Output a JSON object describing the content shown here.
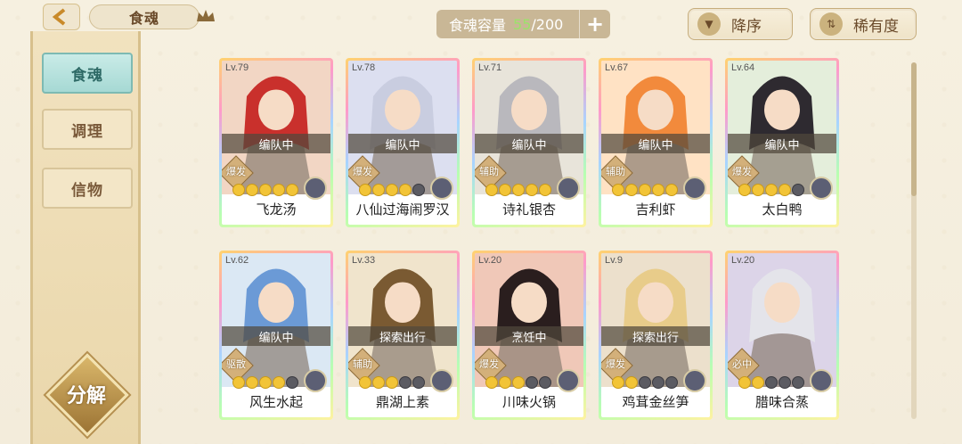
{
  "header": {
    "title_tab": "食魂",
    "capacity_label": "食魂容量",
    "capacity_current": "55",
    "capacity_max": "/200",
    "add_label": "+",
    "sort_order_label": "降序",
    "sort_by_label": "稀有度"
  },
  "sidebar": {
    "tabs": [
      {
        "label": "食魂",
        "active": true
      },
      {
        "label": "调理",
        "active": false
      },
      {
        "label": "信物",
        "active": false
      }
    ],
    "decompose_label": "分解"
  },
  "cards": [
    {
      "level": "Lv.79",
      "status": "编队中",
      "role": "爆发",
      "name": "飞龙汤",
      "stars": 5,
      "stars_filled": 5,
      "hair": "#c9302c",
      "bg": "#f2d6c4"
    },
    {
      "level": "Lv.78",
      "status": "编队中",
      "role": "爆发",
      "name": "八仙过海闹罗汉",
      "stars": 5,
      "stars_filled": 4,
      "hair": "#c9cde0",
      "bg": "#dcdff0"
    },
    {
      "level": "Lv.71",
      "status": "编队中",
      "role": "辅助",
      "name": "诗礼银杏",
      "stars": 5,
      "stars_filled": 5,
      "hair": "#b9b8bd",
      "bg": "#e8e4da"
    },
    {
      "level": "Lv.67",
      "status": "编队中",
      "role": "辅助",
      "name": "吉利虾",
      "stars": 5,
      "stars_filled": 5,
      "hair": "#f28a3c",
      "bg": "#ffe2c4"
    },
    {
      "level": "Lv.64",
      "status": "编队中",
      "role": "爆发",
      "name": "太白鸭",
      "stars": 5,
      "stars_filled": 4,
      "hair": "#2e2a30",
      "bg": "#e4eedb"
    },
    {
      "level": "Lv.62",
      "status": "编队中",
      "role": "驱散",
      "name": "风生水起",
      "stars": 5,
      "stars_filled": 4,
      "hair": "#6b9ad6",
      "bg": "#dbe8f4"
    },
    {
      "level": "Lv.33",
      "status": "探索出行",
      "role": "辅助",
      "name": "鼎湖上素",
      "stars": 5,
      "stars_filled": 3,
      "hair": "#7a5a32",
      "bg": "#f0e4cc"
    },
    {
      "level": "Lv.20",
      "status": "烹饪中",
      "role": "爆发",
      "name": "川味火锅",
      "stars": 5,
      "stars_filled": 3,
      "hair": "#2a1e1e",
      "bg": "#f0c8b8"
    },
    {
      "level": "Lv.9",
      "status": "探索出行",
      "role": "爆发",
      "name": "鸡茸金丝笋",
      "stars": 5,
      "stars_filled": 2,
      "hair": "#e8cc8a",
      "bg": "#ece0cc"
    },
    {
      "level": "Lv.20",
      "status": "",
      "role": "必中",
      "name": "腊味合蒸",
      "stars": 5,
      "stars_filled": 2,
      "hair": "#e4e4ea",
      "bg": "#dcd4e8"
    }
  ]
}
